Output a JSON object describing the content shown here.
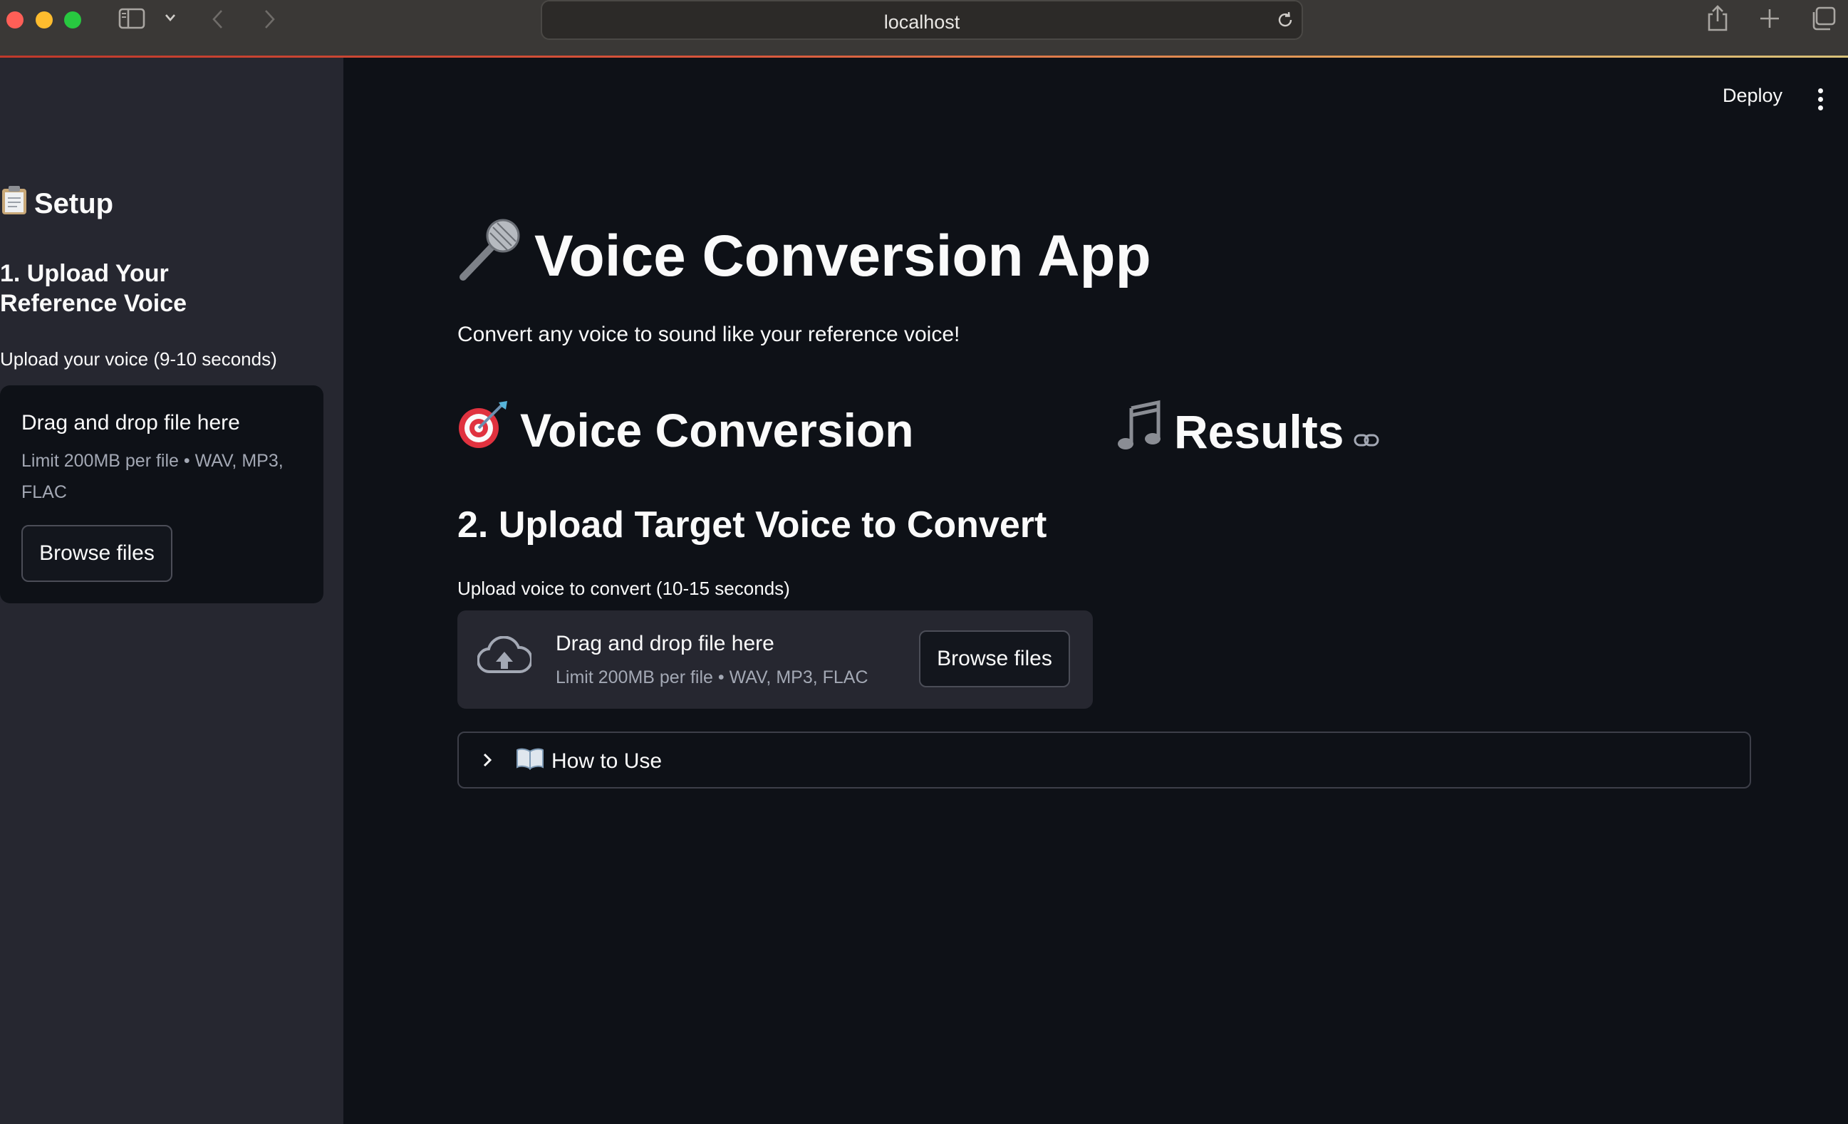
{
  "browser": {
    "url": "localhost"
  },
  "header": {
    "deploy_label": "Deploy"
  },
  "sidebar": {
    "heading": "Setup",
    "step_title": "1. Upload Your Reference Voice",
    "uploader_label": "Upload your voice (9-10 seconds)",
    "dropzone": {
      "title": "Drag and drop file here",
      "limit": "Limit 200MB per file • WAV, MP3, FLAC",
      "button": "Browse files"
    }
  },
  "main": {
    "title": "Voice Conversion App",
    "description": "Convert any voice to sound like your reference voice!",
    "section_conversion": "Voice Conversion",
    "section_results": "Results",
    "step_title": "2. Upload Target Voice to Convert",
    "uploader_label": "Upload voice to convert (10-15 seconds)",
    "dropzone": {
      "title": "Drag and drop file here",
      "limit": "Limit 200MB per file • WAV, MP3, FLAC",
      "button": "Browse files"
    },
    "expander_label": "How to Use"
  },
  "icons": {
    "clipboard": "clipboard-icon",
    "microphone": "microphone-icon",
    "target": "target-icon",
    "music": "music-notes-icon",
    "link": "link-icon",
    "book": "open-book-icon",
    "cloud_upload": "cloud-upload-icon"
  },
  "colors": {
    "background": "#0e1117",
    "sidebar": "#262730",
    "text": "#fafafa",
    "muted": "#a3a8b4"
  }
}
